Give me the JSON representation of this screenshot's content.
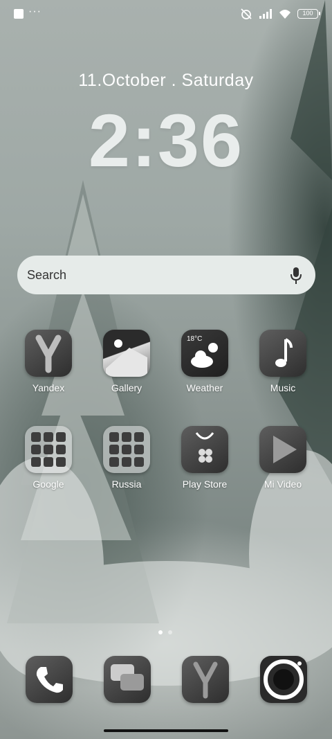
{
  "status_bar": {
    "more": "···",
    "battery": "100"
  },
  "lockscreen": {
    "date": "11.October . Saturday",
    "time": "2:36"
  },
  "search": {
    "placeholder": "Search"
  },
  "apps": [
    {
      "label": "Yandex",
      "icon": "yandex-icon"
    },
    {
      "label": "Gallery",
      "icon": "gallery-icon"
    },
    {
      "label": "Weather",
      "icon": "weather-icon",
      "temp": "18°C"
    },
    {
      "label": "Music",
      "icon": "music-icon"
    },
    {
      "label": "Google",
      "icon": "google-folder-icon"
    },
    {
      "label": "Russia",
      "icon": "russia-folder-icon"
    },
    {
      "label": "Play Store",
      "icon": "play-store-icon"
    },
    {
      "label": "Mi Video",
      "icon": "mi-video-icon"
    }
  ],
  "page_indicator": {
    "pages": 2,
    "active": 1
  },
  "dock": [
    {
      "icon": "phone-icon"
    },
    {
      "icon": "messages-icon"
    },
    {
      "icon": "yandex-browser-icon"
    },
    {
      "icon": "camera-icon"
    }
  ]
}
